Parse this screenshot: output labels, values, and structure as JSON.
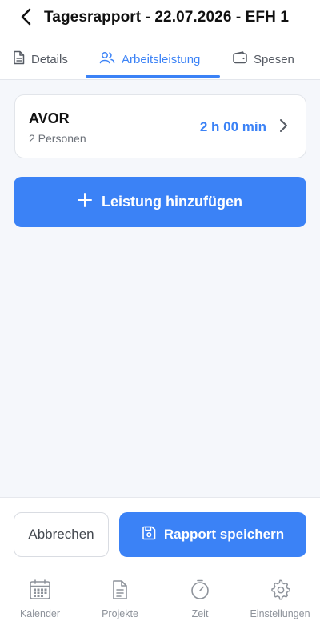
{
  "header": {
    "title": "Tagesrapport - 22.07.2026 - EFH 1",
    "back_icon": "chevron-left-icon"
  },
  "tabs": [
    {
      "label": "Details",
      "icon": "document-icon",
      "active": false
    },
    {
      "label": "Arbeitsleistung",
      "icon": "users-icon",
      "active": true
    },
    {
      "label": "Spesen",
      "icon": "wallet-icon",
      "active": false
    }
  ],
  "work_entries": [
    {
      "name": "AVOR",
      "persons": "2 Personen",
      "duration": "2 h 00 min"
    }
  ],
  "add_button": {
    "label": "Leistung hinzufügen",
    "icon": "plus-icon"
  },
  "actions": {
    "cancel_label": "Abbrechen",
    "save_label": "Rapport speichern",
    "save_icon": "save-icon"
  },
  "bottom_nav": [
    {
      "label": "Kalender",
      "icon": "calendar-icon"
    },
    {
      "label": "Projekte",
      "icon": "document-icon"
    },
    {
      "label": "Zeit",
      "icon": "timer-icon"
    },
    {
      "label": "Einstellungen",
      "icon": "gear-icon"
    }
  ],
  "colors": {
    "accent": "#3b82f6",
    "background": "#f5f7fb",
    "muted_text": "#8e939b"
  }
}
